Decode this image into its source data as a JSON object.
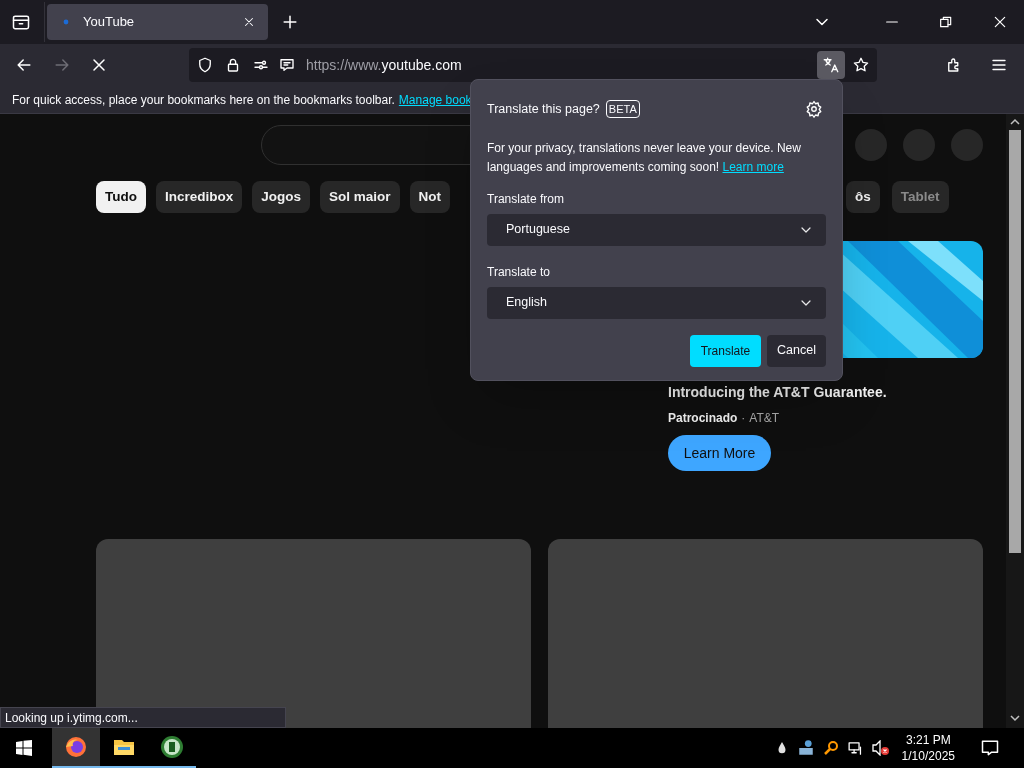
{
  "browser": {
    "tabs": [
      {
        "title": "YouTube",
        "selected": true
      }
    ],
    "address": {
      "scheme": "https://www.",
      "host": "youtube.com"
    },
    "bookmarks_bar": {
      "message": "For quick access, place your bookmarks here on the bookmarks toolbar.",
      "link": "Manage book"
    },
    "translate_button": {
      "selected": true
    },
    "status": "Looking up i.ytimg.com..."
  },
  "page": {
    "chips": [
      {
        "label": "Tudo",
        "selected": true
      },
      {
        "label": "Incredibox",
        "selected": false
      },
      {
        "label": "Jogos",
        "selected": false
      },
      {
        "label": "Sol maior",
        "selected": false
      },
      {
        "label": "Not",
        "selected": false
      },
      {
        "label": "ôs",
        "selected": false
      },
      {
        "label": "Tablet",
        "selected": false
      }
    ],
    "ad": {
      "title": "Introducing the AT&T Guarantee.",
      "sponsor_label": "Patrocinado",
      "separator": "·",
      "advertiser": "AT&T",
      "cta": "Learn More"
    }
  },
  "translate_popup": {
    "title": "Translate this page?",
    "badge": "BETA",
    "description": "For your privacy, translations never leave your device. New languages and improvements coming soon!",
    "link": "Learn more",
    "from_label": "Translate from",
    "from_value": "Portuguese",
    "to_label": "Translate to",
    "to_value": "English",
    "primary": "Translate",
    "secondary": "Cancel"
  },
  "taskbar": {
    "apps": [
      {
        "kind": "browser",
        "selected": true
      },
      {
        "kind": "files",
        "selected": false
      },
      {
        "kind": "app",
        "selected": false
      }
    ],
    "time": "3:21 PM",
    "date": "1/10/2025"
  }
}
